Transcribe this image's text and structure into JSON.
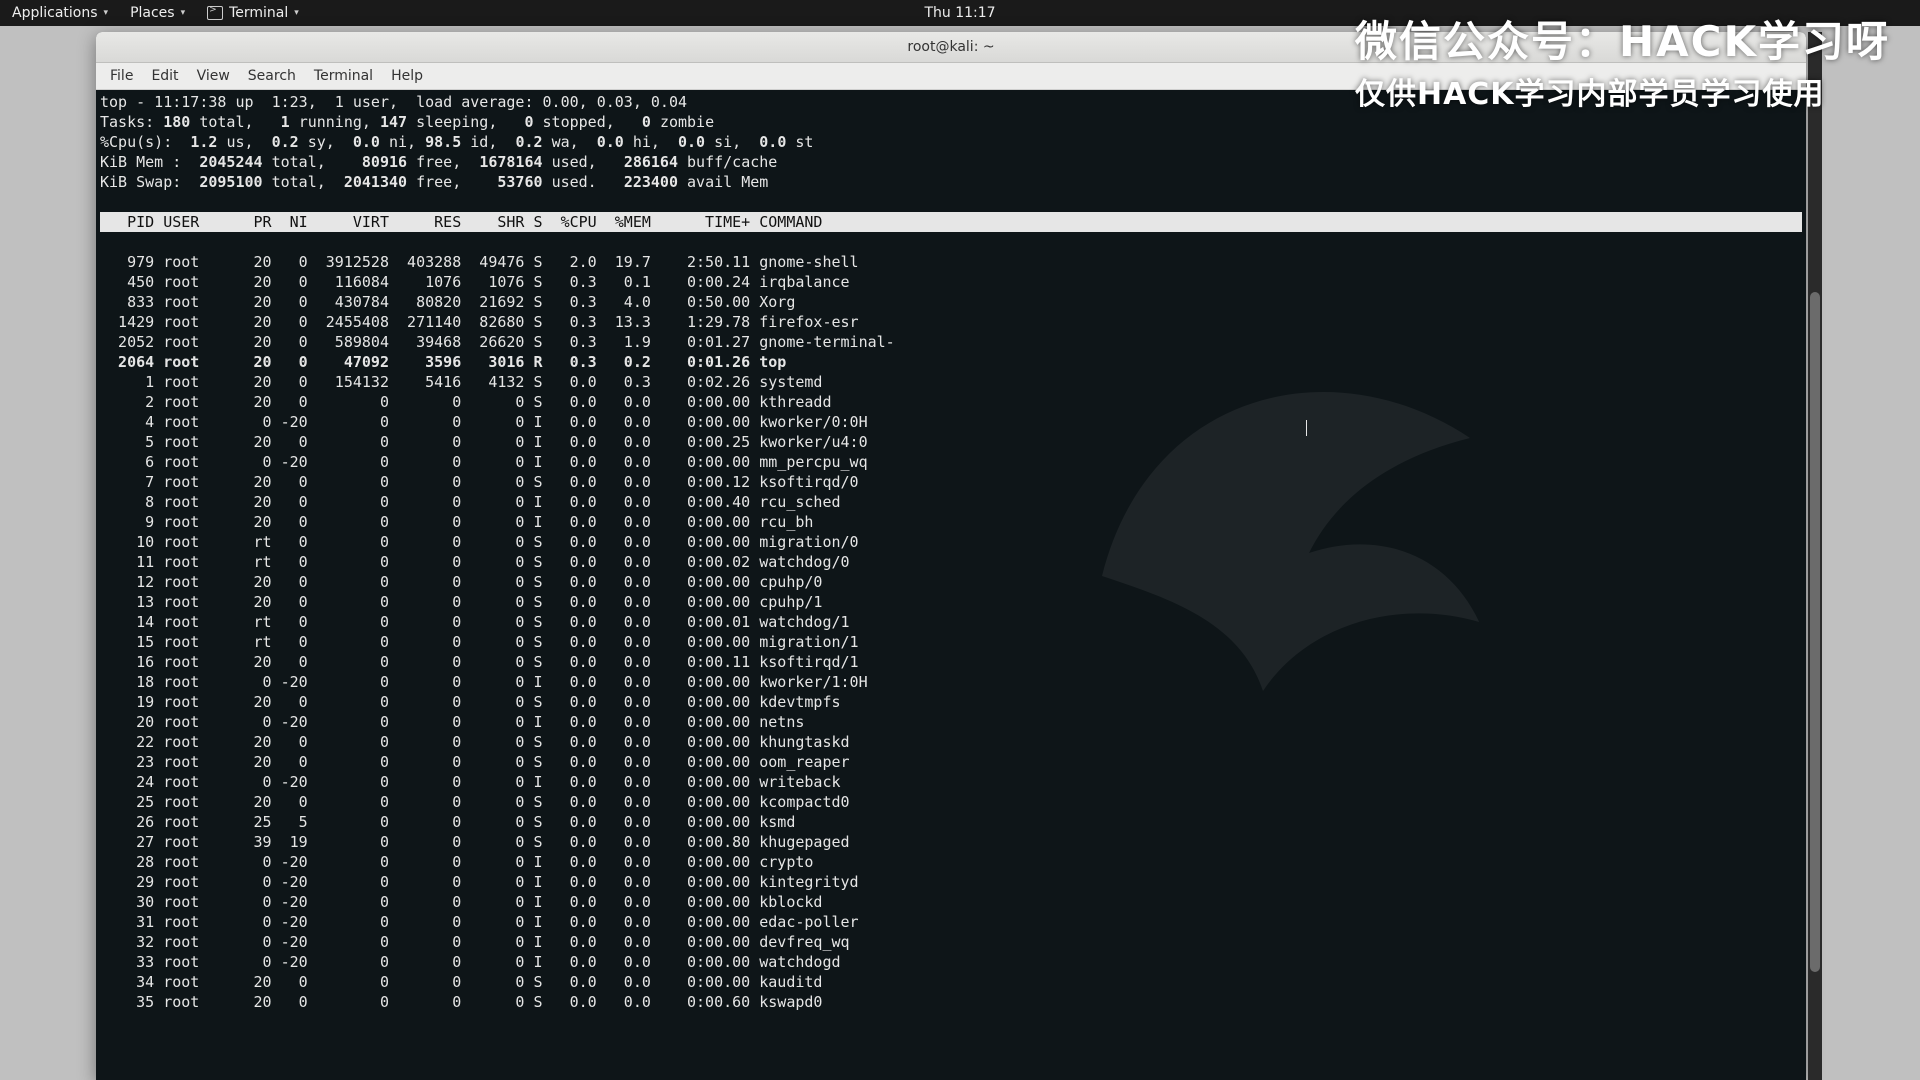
{
  "topbar": {
    "applications": "Applications",
    "places": "Places",
    "terminal": "Terminal",
    "clock": "Thu 11:17"
  },
  "watermark": {
    "line1": "微信公众号：HACK学习呀",
    "line2": "仅供HACK学习内部学员学习使用"
  },
  "window": {
    "title": "root@kali: ~",
    "menus": [
      "File",
      "Edit",
      "View",
      "Search",
      "Terminal",
      "Help"
    ]
  },
  "top_summary": {
    "line1": "top - 11:17:38 up  1:23,  1 user,  load average: 0.00, 0.03, 0.04",
    "tasks": {
      "total": 180,
      "running": 1,
      "sleeping": 147,
      "stopped": 0,
      "zombie": 0
    },
    "cpu": {
      "us": 1.2,
      "sy": 0.2,
      "ni": 0.0,
      "id": 98.5,
      "wa": 0.2,
      "hi": 0.0,
      "si": 0.0,
      "st": 0.0
    },
    "mem": {
      "total": 2045244,
      "free": 80916,
      "used": 1678164,
      "buffcache": 286164
    },
    "swap": {
      "total": 2095100,
      "free": 2041340,
      "used": 53760,
      "avail": 223400
    }
  },
  "columns": [
    "PID",
    "USER",
    "PR",
    "NI",
    "VIRT",
    "RES",
    "SHR",
    "S",
    "%CPU",
    "%MEM",
    "TIME+",
    "COMMAND"
  ],
  "processes": [
    {
      "pid": 979,
      "user": "root",
      "pr": "20",
      "ni": "0",
      "virt": "3912528",
      "res": "403288",
      "shr": "49476",
      "s": "S",
      "cpu": "2.0",
      "mem": "19.7",
      "time": "2:50.11",
      "cmd": "gnome-shell"
    },
    {
      "pid": 450,
      "user": "root",
      "pr": "20",
      "ni": "0",
      "virt": "116084",
      "res": "1076",
      "shr": "1076",
      "s": "S",
      "cpu": "0.3",
      "mem": "0.1",
      "time": "0:00.24",
      "cmd": "irqbalance"
    },
    {
      "pid": 833,
      "user": "root",
      "pr": "20",
      "ni": "0",
      "virt": "430784",
      "res": "80820",
      "shr": "21692",
      "s": "S",
      "cpu": "0.3",
      "mem": "4.0",
      "time": "0:50.00",
      "cmd": "Xorg"
    },
    {
      "pid": 1429,
      "user": "root",
      "pr": "20",
      "ni": "0",
      "virt": "2455408",
      "res": "271140",
      "shr": "82680",
      "s": "S",
      "cpu": "0.3",
      "mem": "13.3",
      "time": "1:29.78",
      "cmd": "firefox-esr"
    },
    {
      "pid": 2052,
      "user": "root",
      "pr": "20",
      "ni": "0",
      "virt": "589804",
      "res": "39468",
      "shr": "26620",
      "s": "S",
      "cpu": "0.3",
      "mem": "1.9",
      "time": "0:01.27",
      "cmd": "gnome-terminal-"
    },
    {
      "pid": 2064,
      "user": "root",
      "pr": "20",
      "ni": "0",
      "virt": "47092",
      "res": "3596",
      "shr": "3016",
      "s": "R",
      "cpu": "0.3",
      "mem": "0.2",
      "time": "0:01.26",
      "cmd": "top",
      "bold": true
    },
    {
      "pid": 1,
      "user": "root",
      "pr": "20",
      "ni": "0",
      "virt": "154132",
      "res": "5416",
      "shr": "4132",
      "s": "S",
      "cpu": "0.0",
      "mem": "0.3",
      "time": "0:02.26",
      "cmd": "systemd"
    },
    {
      "pid": 2,
      "user": "root",
      "pr": "20",
      "ni": "0",
      "virt": "0",
      "res": "0",
      "shr": "0",
      "s": "S",
      "cpu": "0.0",
      "mem": "0.0",
      "time": "0:00.00",
      "cmd": "kthreadd"
    },
    {
      "pid": 4,
      "user": "root",
      "pr": "0",
      "ni": "-20",
      "virt": "0",
      "res": "0",
      "shr": "0",
      "s": "I",
      "cpu": "0.0",
      "mem": "0.0",
      "time": "0:00.00",
      "cmd": "kworker/0:0H"
    },
    {
      "pid": 5,
      "user": "root",
      "pr": "20",
      "ni": "0",
      "virt": "0",
      "res": "0",
      "shr": "0",
      "s": "I",
      "cpu": "0.0",
      "mem": "0.0",
      "time": "0:00.25",
      "cmd": "kworker/u4:0"
    },
    {
      "pid": 6,
      "user": "root",
      "pr": "0",
      "ni": "-20",
      "virt": "0",
      "res": "0",
      "shr": "0",
      "s": "I",
      "cpu": "0.0",
      "mem": "0.0",
      "time": "0:00.00",
      "cmd": "mm_percpu_wq"
    },
    {
      "pid": 7,
      "user": "root",
      "pr": "20",
      "ni": "0",
      "virt": "0",
      "res": "0",
      "shr": "0",
      "s": "S",
      "cpu": "0.0",
      "mem": "0.0",
      "time": "0:00.12",
      "cmd": "ksoftirqd/0"
    },
    {
      "pid": 8,
      "user": "root",
      "pr": "20",
      "ni": "0",
      "virt": "0",
      "res": "0",
      "shr": "0",
      "s": "I",
      "cpu": "0.0",
      "mem": "0.0",
      "time": "0:00.40",
      "cmd": "rcu_sched"
    },
    {
      "pid": 9,
      "user": "root",
      "pr": "20",
      "ni": "0",
      "virt": "0",
      "res": "0",
      "shr": "0",
      "s": "I",
      "cpu": "0.0",
      "mem": "0.0",
      "time": "0:00.00",
      "cmd": "rcu_bh"
    },
    {
      "pid": 10,
      "user": "root",
      "pr": "rt",
      "ni": "0",
      "virt": "0",
      "res": "0",
      "shr": "0",
      "s": "S",
      "cpu": "0.0",
      "mem": "0.0",
      "time": "0:00.00",
      "cmd": "migration/0"
    },
    {
      "pid": 11,
      "user": "root",
      "pr": "rt",
      "ni": "0",
      "virt": "0",
      "res": "0",
      "shr": "0",
      "s": "S",
      "cpu": "0.0",
      "mem": "0.0",
      "time": "0:00.02",
      "cmd": "watchdog/0"
    },
    {
      "pid": 12,
      "user": "root",
      "pr": "20",
      "ni": "0",
      "virt": "0",
      "res": "0",
      "shr": "0",
      "s": "S",
      "cpu": "0.0",
      "mem": "0.0",
      "time": "0:00.00",
      "cmd": "cpuhp/0"
    },
    {
      "pid": 13,
      "user": "root",
      "pr": "20",
      "ni": "0",
      "virt": "0",
      "res": "0",
      "shr": "0",
      "s": "S",
      "cpu": "0.0",
      "mem": "0.0",
      "time": "0:00.00",
      "cmd": "cpuhp/1"
    },
    {
      "pid": 14,
      "user": "root",
      "pr": "rt",
      "ni": "0",
      "virt": "0",
      "res": "0",
      "shr": "0",
      "s": "S",
      "cpu": "0.0",
      "mem": "0.0",
      "time": "0:00.01",
      "cmd": "watchdog/1"
    },
    {
      "pid": 15,
      "user": "root",
      "pr": "rt",
      "ni": "0",
      "virt": "0",
      "res": "0",
      "shr": "0",
      "s": "S",
      "cpu": "0.0",
      "mem": "0.0",
      "time": "0:00.00",
      "cmd": "migration/1"
    },
    {
      "pid": 16,
      "user": "root",
      "pr": "20",
      "ni": "0",
      "virt": "0",
      "res": "0",
      "shr": "0",
      "s": "S",
      "cpu": "0.0",
      "mem": "0.0",
      "time": "0:00.11",
      "cmd": "ksoftirqd/1"
    },
    {
      "pid": 18,
      "user": "root",
      "pr": "0",
      "ni": "-20",
      "virt": "0",
      "res": "0",
      "shr": "0",
      "s": "I",
      "cpu": "0.0",
      "mem": "0.0",
      "time": "0:00.00",
      "cmd": "kworker/1:0H"
    },
    {
      "pid": 19,
      "user": "root",
      "pr": "20",
      "ni": "0",
      "virt": "0",
      "res": "0",
      "shr": "0",
      "s": "S",
      "cpu": "0.0",
      "mem": "0.0",
      "time": "0:00.00",
      "cmd": "kdevtmpfs"
    },
    {
      "pid": 20,
      "user": "root",
      "pr": "0",
      "ni": "-20",
      "virt": "0",
      "res": "0",
      "shr": "0",
      "s": "I",
      "cpu": "0.0",
      "mem": "0.0",
      "time": "0:00.00",
      "cmd": "netns"
    },
    {
      "pid": 22,
      "user": "root",
      "pr": "20",
      "ni": "0",
      "virt": "0",
      "res": "0",
      "shr": "0",
      "s": "S",
      "cpu": "0.0",
      "mem": "0.0",
      "time": "0:00.00",
      "cmd": "khungtaskd"
    },
    {
      "pid": 23,
      "user": "root",
      "pr": "20",
      "ni": "0",
      "virt": "0",
      "res": "0",
      "shr": "0",
      "s": "S",
      "cpu": "0.0",
      "mem": "0.0",
      "time": "0:00.00",
      "cmd": "oom_reaper"
    },
    {
      "pid": 24,
      "user": "root",
      "pr": "0",
      "ni": "-20",
      "virt": "0",
      "res": "0",
      "shr": "0",
      "s": "I",
      "cpu": "0.0",
      "mem": "0.0",
      "time": "0:00.00",
      "cmd": "writeback"
    },
    {
      "pid": 25,
      "user": "root",
      "pr": "20",
      "ni": "0",
      "virt": "0",
      "res": "0",
      "shr": "0",
      "s": "S",
      "cpu": "0.0",
      "mem": "0.0",
      "time": "0:00.00",
      "cmd": "kcompactd0"
    },
    {
      "pid": 26,
      "user": "root",
      "pr": "25",
      "ni": "5",
      "virt": "0",
      "res": "0",
      "shr": "0",
      "s": "S",
      "cpu": "0.0",
      "mem": "0.0",
      "time": "0:00.00",
      "cmd": "ksmd"
    },
    {
      "pid": 27,
      "user": "root",
      "pr": "39",
      "ni": "19",
      "virt": "0",
      "res": "0",
      "shr": "0",
      "s": "S",
      "cpu": "0.0",
      "mem": "0.0",
      "time": "0:00.80",
      "cmd": "khugepaged"
    },
    {
      "pid": 28,
      "user": "root",
      "pr": "0",
      "ni": "-20",
      "virt": "0",
      "res": "0",
      "shr": "0",
      "s": "I",
      "cpu": "0.0",
      "mem": "0.0",
      "time": "0:00.00",
      "cmd": "crypto"
    },
    {
      "pid": 29,
      "user": "root",
      "pr": "0",
      "ni": "-20",
      "virt": "0",
      "res": "0",
      "shr": "0",
      "s": "I",
      "cpu": "0.0",
      "mem": "0.0",
      "time": "0:00.00",
      "cmd": "kintegrityd"
    },
    {
      "pid": 30,
      "user": "root",
      "pr": "0",
      "ni": "-20",
      "virt": "0",
      "res": "0",
      "shr": "0",
      "s": "I",
      "cpu": "0.0",
      "mem": "0.0",
      "time": "0:00.00",
      "cmd": "kblockd"
    },
    {
      "pid": 31,
      "user": "root",
      "pr": "0",
      "ni": "-20",
      "virt": "0",
      "res": "0",
      "shr": "0",
      "s": "I",
      "cpu": "0.0",
      "mem": "0.0",
      "time": "0:00.00",
      "cmd": "edac-poller"
    },
    {
      "pid": 32,
      "user": "root",
      "pr": "0",
      "ni": "-20",
      "virt": "0",
      "res": "0",
      "shr": "0",
      "s": "I",
      "cpu": "0.0",
      "mem": "0.0",
      "time": "0:00.00",
      "cmd": "devfreq_wq"
    },
    {
      "pid": 33,
      "user": "root",
      "pr": "0",
      "ni": "-20",
      "virt": "0",
      "res": "0",
      "shr": "0",
      "s": "I",
      "cpu": "0.0",
      "mem": "0.0",
      "time": "0:00.00",
      "cmd": "watchdogd"
    },
    {
      "pid": 34,
      "user": "root",
      "pr": "20",
      "ni": "0",
      "virt": "0",
      "res": "0",
      "shr": "0",
      "s": "S",
      "cpu": "0.0",
      "mem": "0.0",
      "time": "0:00.00",
      "cmd": "kauditd"
    },
    {
      "pid": 35,
      "user": "root",
      "pr": "20",
      "ni": "0",
      "virt": "0",
      "res": "0",
      "shr": "0",
      "s": "S",
      "cpu": "0.0",
      "mem": "0.0",
      "time": "0:00.60",
      "cmd": "kswapd0"
    }
  ]
}
